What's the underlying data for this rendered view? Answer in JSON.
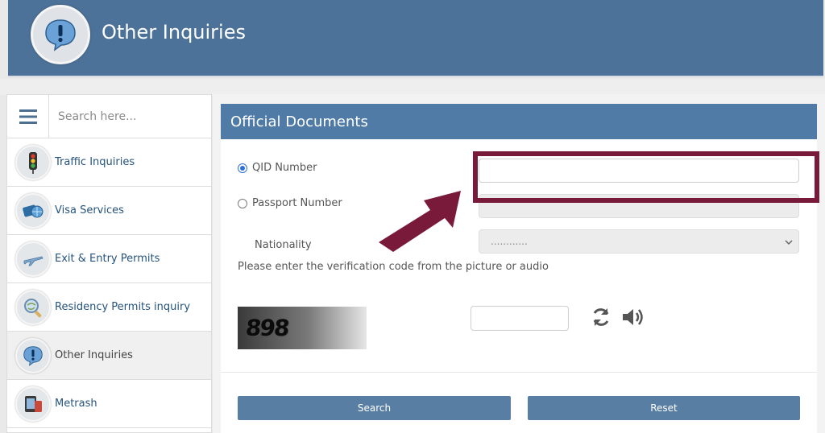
{
  "header": {
    "title": "Other Inquiries",
    "icon": "exclamation-bubble-icon"
  },
  "sidebar": {
    "search_placeholder": "Search here...",
    "items": [
      {
        "label": "Traffic Inquiries",
        "icon": "traffic-light-icon"
      },
      {
        "label": "Visa Services",
        "icon": "visa-icon"
      },
      {
        "label": "Exit & Entry Permits",
        "icon": "airplane-icon"
      },
      {
        "label": "Residency Permits inquiry",
        "icon": "magnifier-globe-icon"
      },
      {
        "label": "Other Inquiries",
        "icon": "exclamation-bubble-icon",
        "active": true
      },
      {
        "label": "Metrash",
        "icon": "phone-device-icon"
      }
    ]
  },
  "form": {
    "title": "Official Documents",
    "qid_label": "QID Number",
    "passport_label": "Passport Number",
    "nationality_label": "Nationality",
    "nationality_value": "............",
    "verification_text": "Please enter the verification code from the picture or audio",
    "captcha_text": "898",
    "search_label": "Search",
    "reset_label": "Reset",
    "selected_option": "QID Number"
  },
  "colors": {
    "header_bg": "#4d7299",
    "panel_title_bg": "#4f7ba6",
    "button_bg": "#587fa3",
    "highlight": "#7a1a3a"
  }
}
